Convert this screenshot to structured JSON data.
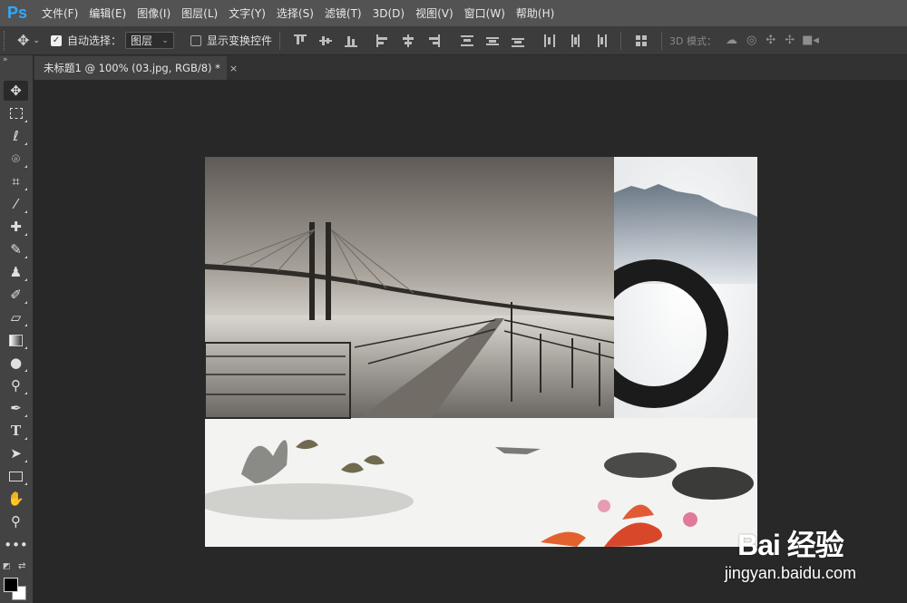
{
  "app": {
    "logo": "Ps"
  },
  "menu": [
    "文件(F)",
    "编辑(E)",
    "图像(I)",
    "图层(L)",
    "文字(Y)",
    "选择(S)",
    "滤镜(T)",
    "3D(D)",
    "视图(V)",
    "窗口(W)",
    "帮助(H)"
  ],
  "options": {
    "auto_select_label": "自动选择：",
    "auto_select_checked": true,
    "auto_select_value": "图层",
    "show_transform_label": "显示变换控件",
    "show_transform_checked": false,
    "mode_3d_label": "3D 模式："
  },
  "document": {
    "tab_title": "未标题1 @ 100% (03.jpg, RGB/8) *",
    "close": "×"
  },
  "tools": [
    "move-tool",
    "marquee-tool",
    "lasso-tool",
    "quick-select-tool",
    "crop-tool",
    "eyedropper-tool",
    "healing-brush-tool",
    "brush-tool",
    "clone-stamp-tool",
    "history-brush-tool",
    "eraser-tool",
    "gradient-tool",
    "blur-tool",
    "dodge-tool",
    "pen-tool",
    "type-tool",
    "path-select-tool",
    "rectangle-tool",
    "hand-tool",
    "zoom-tool",
    "more-tools"
  ],
  "colors": {
    "foreground": "#000000",
    "background": "#ffffff",
    "accent": "#31a8ff"
  },
  "watermark": {
    "top": "Bai 经验",
    "bottom": "jingyan.baidu.com"
  }
}
